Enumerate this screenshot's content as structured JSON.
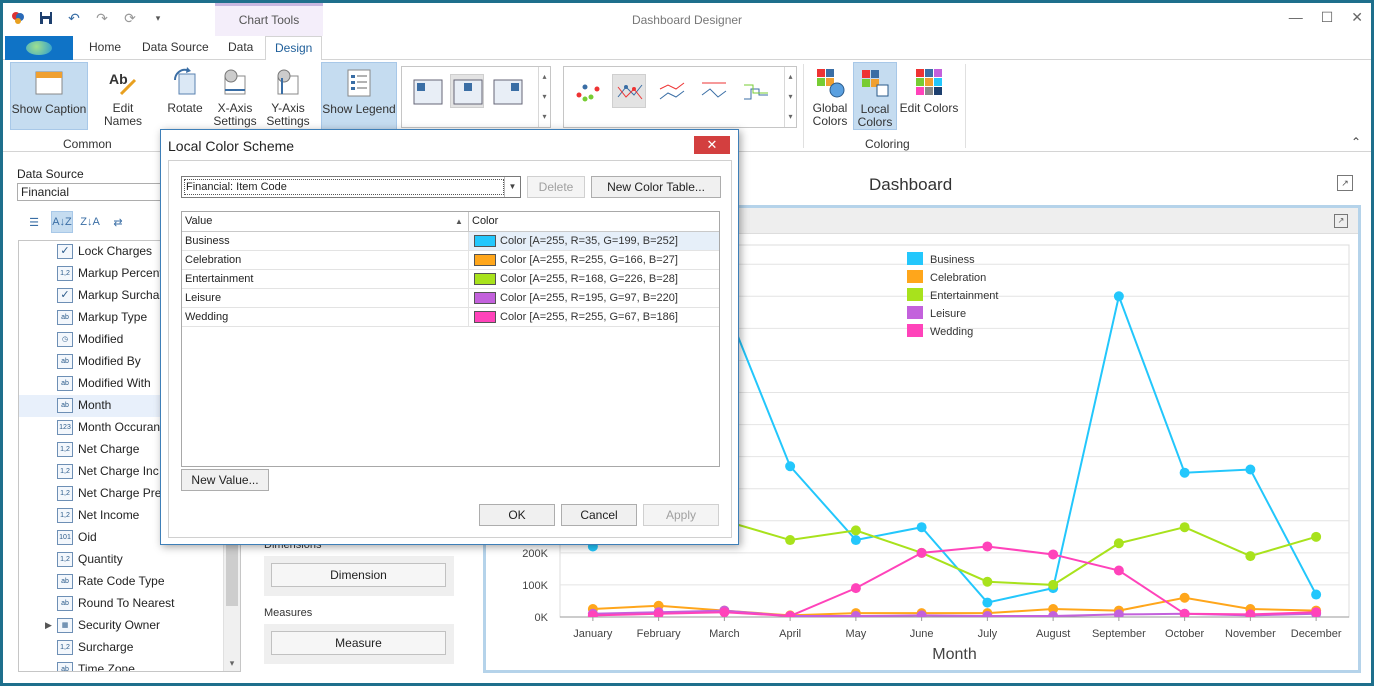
{
  "app": {
    "title": "Dashboard Designer",
    "context_tab": "Chart Tools",
    "window_controls": [
      "—",
      "☐",
      "✕"
    ]
  },
  "tabs": [
    "Home",
    "Data Source",
    "Data",
    "Design"
  ],
  "active_tab": "Design",
  "ribbon": {
    "buttons": {
      "show_caption": "Show Caption",
      "edit_names": "Edit Names",
      "rotate": "Rotate",
      "x_axis": [
        "X-Axis",
        "Settings"
      ],
      "y_axis": [
        "Y-Axis",
        "Settings"
      ],
      "show_legend": "Show Legend",
      "global_colors": [
        "Global",
        "Colors"
      ],
      "local_colors": [
        "Local",
        "Colors"
      ],
      "edit_colors": "Edit Colors"
    },
    "groups": {
      "common": "Common",
      "coloring": "Coloring"
    }
  },
  "left_panel": {
    "data_source_label": "Data Source",
    "data_source_value": "Financial",
    "fields": [
      {
        "name": "Lock Charges",
        "icon": "check"
      },
      {
        "name": "Markup Percenta",
        "icon": "1,2"
      },
      {
        "name": "Markup Surcharg",
        "icon": "check"
      },
      {
        "name": "Markup Type",
        "icon": "ab"
      },
      {
        "name": "Modified",
        "icon": "clock"
      },
      {
        "name": "Modified By",
        "icon": "ab"
      },
      {
        "name": "Modified With",
        "icon": "ab"
      },
      {
        "name": "Month",
        "icon": "ab"
      },
      {
        "name": "Month Occurance",
        "icon": "123"
      },
      {
        "name": "Net Charge",
        "icon": "1,2"
      },
      {
        "name": "Net Charge Inc T",
        "icon": "1,2"
      },
      {
        "name": "Net Charge Pre T",
        "icon": "1,2"
      },
      {
        "name": "Net Income",
        "icon": "1,2"
      },
      {
        "name": "Oid",
        "icon": "101"
      },
      {
        "name": "Quantity",
        "icon": "1,2"
      },
      {
        "name": "Rate Code Type",
        "icon": "ab"
      },
      {
        "name": "Round To Nearest",
        "icon": "ab"
      },
      {
        "name": "Security Owner",
        "icon": "table",
        "expandable": true
      },
      {
        "name": "Surcharge",
        "icon": "1,2"
      },
      {
        "name": "Time Zone",
        "icon": "ab"
      }
    ]
  },
  "bindings": {
    "dimensions_label": "Dimensions",
    "dimension_button": "Dimension",
    "measures_label": "Measures",
    "measure_button": "Measure"
  },
  "dashboard": {
    "title": "Dashboard"
  },
  "dialog": {
    "title": "Local Color Scheme",
    "scheme": "Financial: Item Code",
    "delete_button": "Delete",
    "new_table_button": "New Color Table...",
    "col_value": "Value",
    "col_color": "Color",
    "rows": [
      {
        "value": "Business",
        "color_text": "Color [A=255, R=35, G=199, B=252]",
        "hex": "#23c7fc"
      },
      {
        "value": "Celebration",
        "color_text": "Color [A=255, R=255, G=166, B=27]",
        "hex": "#ffa61b"
      },
      {
        "value": "Entertainment",
        "color_text": "Color [A=255, R=168, G=226, B=28]",
        "hex": "#a8e21c"
      },
      {
        "value": "Leisure",
        "color_text": "Color [A=255, R=195, G=97, B=220]",
        "hex": "#c361dc"
      },
      {
        "value": "Wedding",
        "color_text": "Color [A=255, R=255, G=67, B=186]",
        "hex": "#ff43ba"
      }
    ],
    "new_value_button": "New Value...",
    "ok": "OK",
    "cancel": "Cancel",
    "apply": "Apply"
  },
  "chart_data": {
    "type": "line",
    "xlabel": "Month",
    "ylabel": "",
    "categories": [
      "January",
      "February",
      "March",
      "April",
      "May",
      "June",
      "July",
      "August",
      "September",
      "October",
      "November",
      "December"
    ],
    "y_tick_labels": [
      "0K",
      "100K",
      "200K"
    ],
    "ylim": [
      0,
      1160000
    ],
    "legend_position": "top-right",
    "series": [
      {
        "name": "Business",
        "color": "#23c7fc",
        "values": [
          220000,
          1040000,
          980000,
          470000,
          240000,
          280000,
          45000,
          90000,
          1000000,
          450000,
          460000,
          70000
        ]
      },
      {
        "name": "Celebration",
        "color": "#ffa61b",
        "values": [
          25000,
          35000,
          20000,
          5000,
          12000,
          12000,
          12000,
          25000,
          20000,
          60000,
          25000,
          20000
        ]
      },
      {
        "name": "Entertainment",
        "color": "#a8e21c",
        "values": [
          320000,
          310000,
          300000,
          240000,
          270000,
          200000,
          110000,
          100000,
          230000,
          280000,
          190000,
          250000
        ]
      },
      {
        "name": "Leisure",
        "color": "#c361dc",
        "values": [
          10000,
          15000,
          20000,
          3000,
          3000,
          5000,
          3000,
          3000,
          8000,
          10000,
          5000,
          10000
        ]
      },
      {
        "name": "Wedding",
        "color": "#ff43ba",
        "values": [
          5000,
          10000,
          15000,
          3000,
          90000,
          200000,
          220000,
          195000,
          145000,
          10000,
          8000,
          15000
        ]
      }
    ]
  }
}
